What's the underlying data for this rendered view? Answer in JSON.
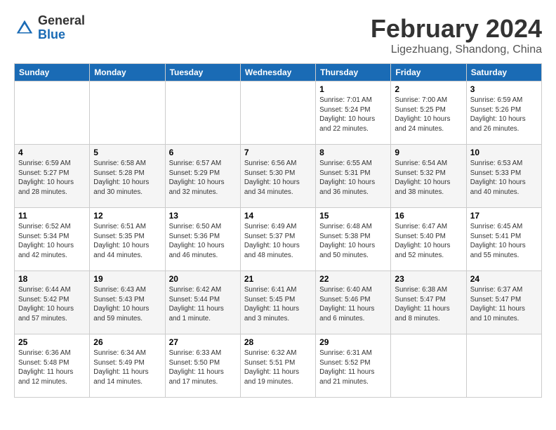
{
  "logo": {
    "general": "General",
    "blue": "Blue"
  },
  "title": "February 2024",
  "location": "Ligezhuang, Shandong, China",
  "weekdays": [
    "Sunday",
    "Monday",
    "Tuesday",
    "Wednesday",
    "Thursday",
    "Friday",
    "Saturday"
  ],
  "weeks": [
    [
      {
        "day": "",
        "info": ""
      },
      {
        "day": "",
        "info": ""
      },
      {
        "day": "",
        "info": ""
      },
      {
        "day": "",
        "info": ""
      },
      {
        "day": "1",
        "info": "Sunrise: 7:01 AM\nSunset: 5:24 PM\nDaylight: 10 hours\nand 22 minutes."
      },
      {
        "day": "2",
        "info": "Sunrise: 7:00 AM\nSunset: 5:25 PM\nDaylight: 10 hours\nand 24 minutes."
      },
      {
        "day": "3",
        "info": "Sunrise: 6:59 AM\nSunset: 5:26 PM\nDaylight: 10 hours\nand 26 minutes."
      }
    ],
    [
      {
        "day": "4",
        "info": "Sunrise: 6:59 AM\nSunset: 5:27 PM\nDaylight: 10 hours\nand 28 minutes."
      },
      {
        "day": "5",
        "info": "Sunrise: 6:58 AM\nSunset: 5:28 PM\nDaylight: 10 hours\nand 30 minutes."
      },
      {
        "day": "6",
        "info": "Sunrise: 6:57 AM\nSunset: 5:29 PM\nDaylight: 10 hours\nand 32 minutes."
      },
      {
        "day": "7",
        "info": "Sunrise: 6:56 AM\nSunset: 5:30 PM\nDaylight: 10 hours\nand 34 minutes."
      },
      {
        "day": "8",
        "info": "Sunrise: 6:55 AM\nSunset: 5:31 PM\nDaylight: 10 hours\nand 36 minutes."
      },
      {
        "day": "9",
        "info": "Sunrise: 6:54 AM\nSunset: 5:32 PM\nDaylight: 10 hours\nand 38 minutes."
      },
      {
        "day": "10",
        "info": "Sunrise: 6:53 AM\nSunset: 5:33 PM\nDaylight: 10 hours\nand 40 minutes."
      }
    ],
    [
      {
        "day": "11",
        "info": "Sunrise: 6:52 AM\nSunset: 5:34 PM\nDaylight: 10 hours\nand 42 minutes."
      },
      {
        "day": "12",
        "info": "Sunrise: 6:51 AM\nSunset: 5:35 PM\nDaylight: 10 hours\nand 44 minutes."
      },
      {
        "day": "13",
        "info": "Sunrise: 6:50 AM\nSunset: 5:36 PM\nDaylight: 10 hours\nand 46 minutes."
      },
      {
        "day": "14",
        "info": "Sunrise: 6:49 AM\nSunset: 5:37 PM\nDaylight: 10 hours\nand 48 minutes."
      },
      {
        "day": "15",
        "info": "Sunrise: 6:48 AM\nSunset: 5:38 PM\nDaylight: 10 hours\nand 50 minutes."
      },
      {
        "day": "16",
        "info": "Sunrise: 6:47 AM\nSunset: 5:40 PM\nDaylight: 10 hours\nand 52 minutes."
      },
      {
        "day": "17",
        "info": "Sunrise: 6:45 AM\nSunset: 5:41 PM\nDaylight: 10 hours\nand 55 minutes."
      }
    ],
    [
      {
        "day": "18",
        "info": "Sunrise: 6:44 AM\nSunset: 5:42 PM\nDaylight: 10 hours\nand 57 minutes."
      },
      {
        "day": "19",
        "info": "Sunrise: 6:43 AM\nSunset: 5:43 PM\nDaylight: 10 hours\nand 59 minutes."
      },
      {
        "day": "20",
        "info": "Sunrise: 6:42 AM\nSunset: 5:44 PM\nDaylight: 11 hours\nand 1 minute."
      },
      {
        "day": "21",
        "info": "Sunrise: 6:41 AM\nSunset: 5:45 PM\nDaylight: 11 hours\nand 3 minutes."
      },
      {
        "day": "22",
        "info": "Sunrise: 6:40 AM\nSunset: 5:46 PM\nDaylight: 11 hours\nand 6 minutes."
      },
      {
        "day": "23",
        "info": "Sunrise: 6:38 AM\nSunset: 5:47 PM\nDaylight: 11 hours\nand 8 minutes."
      },
      {
        "day": "24",
        "info": "Sunrise: 6:37 AM\nSunset: 5:47 PM\nDaylight: 11 hours\nand 10 minutes."
      }
    ],
    [
      {
        "day": "25",
        "info": "Sunrise: 6:36 AM\nSunset: 5:48 PM\nDaylight: 11 hours\nand 12 minutes."
      },
      {
        "day": "26",
        "info": "Sunrise: 6:34 AM\nSunset: 5:49 PM\nDaylight: 11 hours\nand 14 minutes."
      },
      {
        "day": "27",
        "info": "Sunrise: 6:33 AM\nSunset: 5:50 PM\nDaylight: 11 hours\nand 17 minutes."
      },
      {
        "day": "28",
        "info": "Sunrise: 6:32 AM\nSunset: 5:51 PM\nDaylight: 11 hours\nand 19 minutes."
      },
      {
        "day": "29",
        "info": "Sunrise: 6:31 AM\nSunset: 5:52 PM\nDaylight: 11 hours\nand 21 minutes."
      },
      {
        "day": "",
        "info": ""
      },
      {
        "day": "",
        "info": ""
      }
    ]
  ]
}
